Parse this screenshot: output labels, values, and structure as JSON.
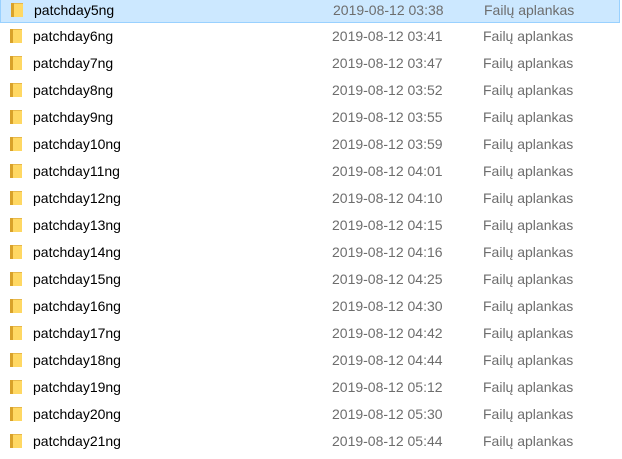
{
  "files": [
    {
      "name": "patchday5ng",
      "date": "2019-08-12 03:38",
      "type": "Failų aplankas",
      "icon": "folder-icon",
      "selected": true
    },
    {
      "name": "patchday6ng",
      "date": "2019-08-12 03:41",
      "type": "Failų aplankas",
      "icon": "folder-icon",
      "selected": false
    },
    {
      "name": "patchday7ng",
      "date": "2019-08-12 03:47",
      "type": "Failų aplankas",
      "icon": "folder-icon",
      "selected": false
    },
    {
      "name": "patchday8ng",
      "date": "2019-08-12 03:52",
      "type": "Failų aplankas",
      "icon": "folder-icon",
      "selected": false
    },
    {
      "name": "patchday9ng",
      "date": "2019-08-12 03:55",
      "type": "Failų aplankas",
      "icon": "folder-icon",
      "selected": false
    },
    {
      "name": "patchday10ng",
      "date": "2019-08-12 03:59",
      "type": "Failų aplankas",
      "icon": "folder-icon",
      "selected": false
    },
    {
      "name": "patchday11ng",
      "date": "2019-08-12 04:01",
      "type": "Failų aplankas",
      "icon": "folder-icon",
      "selected": false
    },
    {
      "name": "patchday12ng",
      "date": "2019-08-12 04:10",
      "type": "Failų aplankas",
      "icon": "folder-icon",
      "selected": false
    },
    {
      "name": "patchday13ng",
      "date": "2019-08-12 04:15",
      "type": "Failų aplankas",
      "icon": "folder-icon",
      "selected": false
    },
    {
      "name": "patchday14ng",
      "date": "2019-08-12 04:16",
      "type": "Failų aplankas",
      "icon": "folder-icon",
      "selected": false
    },
    {
      "name": "patchday15ng",
      "date": "2019-08-12 04:25",
      "type": "Failų aplankas",
      "icon": "folder-icon",
      "selected": false
    },
    {
      "name": "patchday16ng",
      "date": "2019-08-12 04:30",
      "type": "Failų aplankas",
      "icon": "folder-icon",
      "selected": false
    },
    {
      "name": "patchday17ng",
      "date": "2019-08-12 04:42",
      "type": "Failų aplankas",
      "icon": "folder-icon",
      "selected": false
    },
    {
      "name": "patchday18ng",
      "date": "2019-08-12 04:44",
      "type": "Failų aplankas",
      "icon": "folder-icon",
      "selected": false
    },
    {
      "name": "patchday19ng",
      "date": "2019-08-12 05:12",
      "type": "Failų aplankas",
      "icon": "folder-icon",
      "selected": false
    },
    {
      "name": "patchday20ng",
      "date": "2019-08-12 05:30",
      "type": "Failų aplankas",
      "icon": "folder-icon",
      "selected": false
    },
    {
      "name": "patchday21ng",
      "date": "2019-08-12 05:44",
      "type": "Failų aplankas",
      "icon": "folder-icon",
      "selected": false
    }
  ],
  "colors": {
    "selection_bg": "#cce8ff",
    "selection_border": "#99d1ff",
    "folder_yellow": "#ffd863",
    "folder_dark": "#e0a800",
    "secondary_text": "#6d6d6d"
  }
}
